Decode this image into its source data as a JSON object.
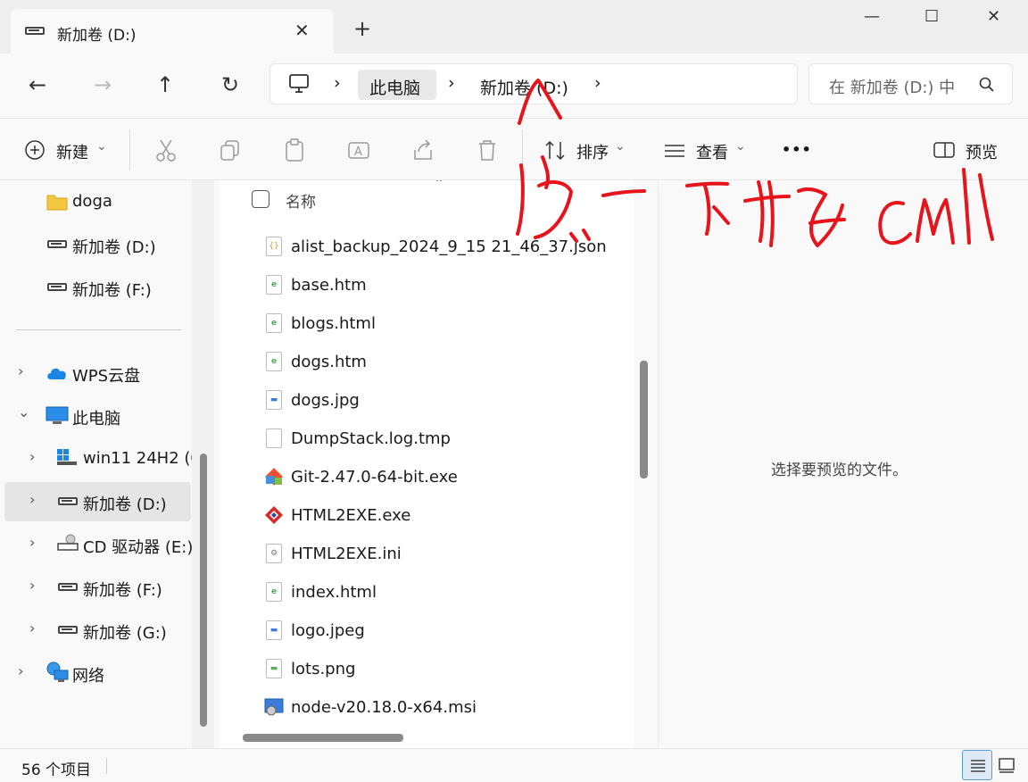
{
  "window": {
    "tab_title": "新加卷 (D:)",
    "tab_close": "✕",
    "new_tab": "+",
    "minimize": "—",
    "maximize": "☐",
    "close": "✕"
  },
  "nav": {
    "back": "←",
    "forward": "→",
    "up": "↑",
    "refresh": "↻"
  },
  "address": {
    "breadcrumbs": [
      "此电脑",
      "新加卷 (D:)"
    ],
    "separator": "›"
  },
  "search": {
    "placeholder": "在 新加卷 (D:) 中"
  },
  "toolbar": {
    "new_label": "新建",
    "sort_label": "排序",
    "view_label": "查看",
    "more_label": "•••",
    "preview_label": "预览",
    "dropdown_caret": "⌄"
  },
  "sidebar": {
    "items": [
      {
        "label": "doga",
        "icon": "folder-icon"
      },
      {
        "label": "新加卷 (D:)",
        "icon": "drive-icon"
      },
      {
        "label": "新加卷 (F:)",
        "icon": "drive-icon"
      },
      {
        "label": "WPS云盘",
        "icon": "cloud-icon"
      },
      {
        "label": "此电脑",
        "icon": "computer-icon"
      },
      {
        "label": "win11 24H2 (C",
        "icon": "windows-drive-icon"
      },
      {
        "label": "新加卷 (D:)",
        "icon": "drive-icon"
      },
      {
        "label": "CD 驱动器 (E:)",
        "icon": "cd-drive-icon"
      },
      {
        "label": "新加卷 (F:)",
        "icon": "drive-icon"
      },
      {
        "label": "新加卷 (G:)",
        "icon": "drive-icon"
      },
      {
        "label": "网络",
        "icon": "network-icon"
      }
    ]
  },
  "filelist": {
    "column_name": "名称",
    "sort_caret": "⌃",
    "files": [
      {
        "name": "alist_backup_2024_9_15 21_46_37.json",
        "icon": "json-file-icon"
      },
      {
        "name": "base.htm",
        "icon": "html-file-icon"
      },
      {
        "name": "blogs.html",
        "icon": "html-file-icon"
      },
      {
        "name": "dogs.htm",
        "icon": "html-file-icon"
      },
      {
        "name": "dogs.jpg",
        "icon": "jpg-file-icon"
      },
      {
        "name": "DumpStack.log.tmp",
        "icon": "blank-file-icon"
      },
      {
        "name": "Git-2.47.0-64-bit.exe",
        "icon": "git-installer-icon"
      },
      {
        "name": "HTML2EXE.exe",
        "icon": "html2exe-icon"
      },
      {
        "name": "HTML2EXE.ini",
        "icon": "ini-file-icon"
      },
      {
        "name": "index.html",
        "icon": "html-file-icon"
      },
      {
        "name": "logo.jpeg",
        "icon": "jpg-file-icon"
      },
      {
        "name": "lots.png",
        "icon": "png-file-icon"
      },
      {
        "name": "node-v20.18.0-x64.msi",
        "icon": "msi-file-icon"
      }
    ]
  },
  "preview": {
    "message": "选择要预览的文件。"
  },
  "status": {
    "item_count": "56 个项目"
  },
  "colors": {
    "annotation": "#e8141c",
    "accent": "#005fb8"
  }
}
